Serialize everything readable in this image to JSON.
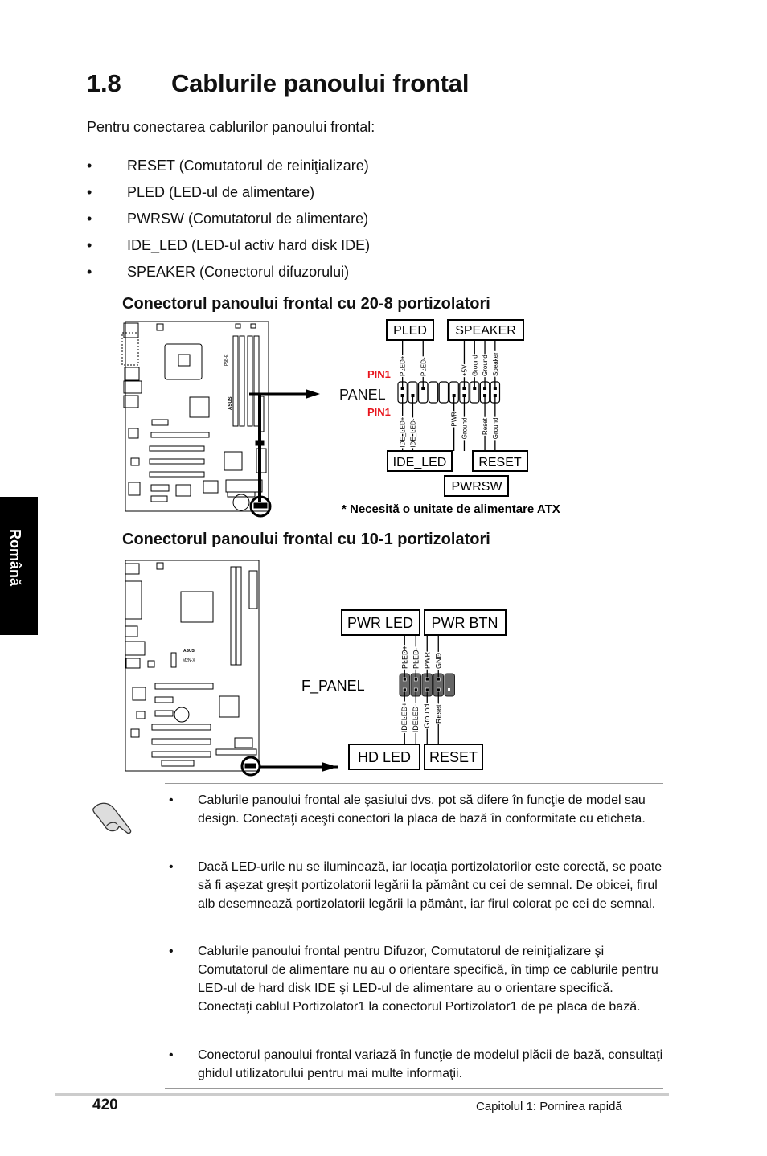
{
  "heading": {
    "number": "1.8",
    "title": "Cablurile panoului frontal"
  },
  "intro": "Pentru conectarea cablurilor panoului frontal:",
  "bullets": [
    "RESET (Comutatorul de reiniţializare)",
    "PLED (LED-ul de alimentare)",
    "PWRSW (Comutatorul de alimentare)",
    "IDE_LED (LED-ul activ hard disk IDE)",
    "SPEAKER (Conectorul difuzorului)"
  ],
  "bullet_glyph": "•",
  "side_tab": "Română",
  "diagram1": {
    "title": "Conectorul panoului frontal cu 20-8 portizolatori",
    "board_model": "P5B-E",
    "brand": "ASUS",
    "header_label": "PANEL",
    "pin1_label": "PIN1",
    "groups_top": [
      "PLED",
      "SPEAKER"
    ],
    "groups_bottom": [
      "IDE_LED",
      "RESET",
      "PWRSW"
    ],
    "top_pins": [
      {
        "col": 1,
        "label": "PLED+"
      },
      {
        "col": 3,
        "label": "PLED-"
      },
      {
        "col": 7,
        "label": "+5V"
      },
      {
        "col": 8,
        "label": "Ground"
      },
      {
        "col": 9,
        "label": "Ground"
      },
      {
        "col": 10,
        "label": "Speaker"
      }
    ],
    "bottom_pins": [
      {
        "col": 1,
        "label": "IDE_LED+"
      },
      {
        "col": 2,
        "label": "IDE_LED-"
      },
      {
        "col": 6,
        "label": "PWR"
      },
      {
        "col": 7,
        "label": "Ground"
      },
      {
        "col": 9,
        "label": "Reset"
      },
      {
        "col": 10,
        "label": "Ground"
      }
    ],
    "footnote": "* Necesită o unitate de alimentare ATX",
    "pin1_color": "#e8141c"
  },
  "diagram2": {
    "title": "Conectorul panoului frontal cu 10-1 portizolatori",
    "board_model": "M2N-X",
    "brand": "ASUS",
    "header_label": "F_PANEL",
    "groups_top": [
      "PWR LED",
      "PWR BTN"
    ],
    "groups_bottom": [
      "HD  LED",
      "RESET"
    ],
    "top_pins": [
      "PLED+",
      "PLED-",
      "PWR",
      "GND"
    ],
    "bottom_pins": [
      "IDELED+",
      "IDELED-",
      "Ground",
      "Reset"
    ]
  },
  "notes": [
    "Cablurile panoului frontal ale şasiului dvs. pot să difere în funcţie de model sau design. Conectaţi aceşti conectori la placa de bază în conformitate cu eticheta.",
    "Dacă LED-urile nu se iluminează, iar locaţia portizolatorilor este corectă, se poate să fi aşezat greşit portizolatorii legării la pământ cu cei de semnal. De obicei, firul alb desemnează portizolatorii legării la pământ, iar firul colorat pe cei de semnal.",
    "Cablurile panoului frontal pentru Difuzor, Comutatorul de reiniţializare şi Comutatorul de alimentare nu au o orientare specifică, în timp ce cablurile pentru LED-ul de hard disk IDE şi LED-ul de alimentare au o orientare specifică. Conectaţi cablul Portizolator1 la conectorul Portizolator1 de pe placa de bază.",
    "Conectorul panoului frontal variază în funcţie de modelul plăcii de bază, consultaţi ghidul utilizatorului pentru mai multe informaţii."
  ],
  "footer": {
    "page": "420",
    "chapter": "Capitolul 1: Pornirea rapidă"
  }
}
